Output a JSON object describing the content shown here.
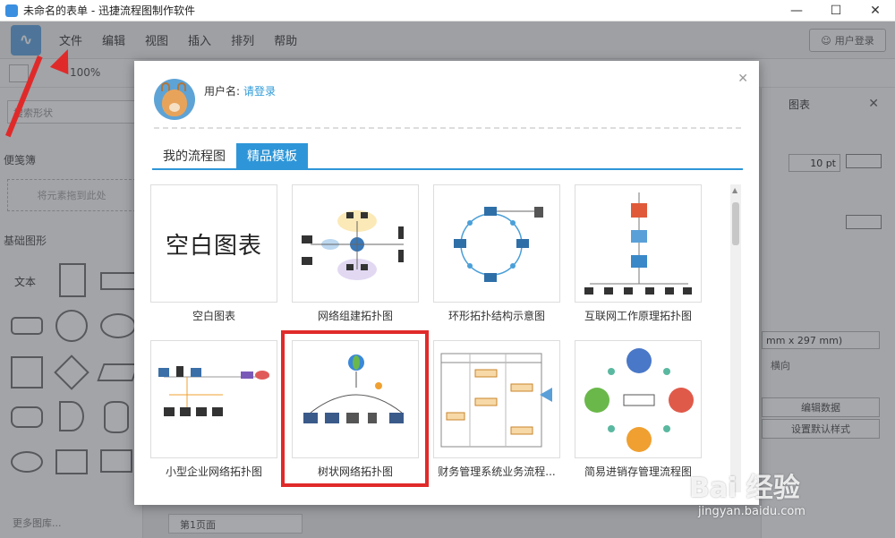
{
  "window": {
    "title": "未命名的表单 - 迅捷流程图制作软件",
    "controls": [
      "—",
      "☐",
      "✕"
    ]
  },
  "menubar": {
    "items": [
      "文件",
      "编辑",
      "视图",
      "插入",
      "排列",
      "帮助"
    ],
    "login_label": "用户登录"
  },
  "toolbar": {
    "zoom": "100%"
  },
  "sidebar": {
    "search_placeholder": "搜索形状",
    "scratchpad_label": "便笺簿",
    "drop_hint": "将元素拖到此处",
    "basic_shapes_label": "基础图形",
    "text_shape_label": "文本",
    "more_label": "更多图库..."
  },
  "right_panel": {
    "title": "图表",
    "pt_value": "10 pt",
    "paper_size": "mm x 297 mm)",
    "orientation": "横向",
    "edit_data_label": "编辑数据",
    "default_style_label": "设置默认样式"
  },
  "canvas": {
    "page_tab": "第1页面"
  },
  "modal": {
    "user_label": "用户名:",
    "login_link": "请登录",
    "tabs": [
      "我的流程图",
      "精品模板"
    ],
    "active_tab": 1,
    "templates": [
      {
        "label": "空白图表",
        "thumb_text": "空白图表"
      },
      {
        "label": "网络组建拓扑图"
      },
      {
        "label": "环形拓扑结构示意图"
      },
      {
        "label": "互联网工作原理拓扑图"
      },
      {
        "label": "小型企业网络拓扑图"
      },
      {
        "label": "树状网络拓扑图"
      },
      {
        "label": "财务管理系统业务流程..."
      },
      {
        "label": "简易进销存管理流程图"
      }
    ],
    "highlighted_template": 5
  },
  "watermark": {
    "main": "Bai 经验",
    "sub": "jingyan.baidu.com"
  },
  "colors": {
    "accent": "#2e96d8",
    "annotation": "#e02a2a"
  }
}
